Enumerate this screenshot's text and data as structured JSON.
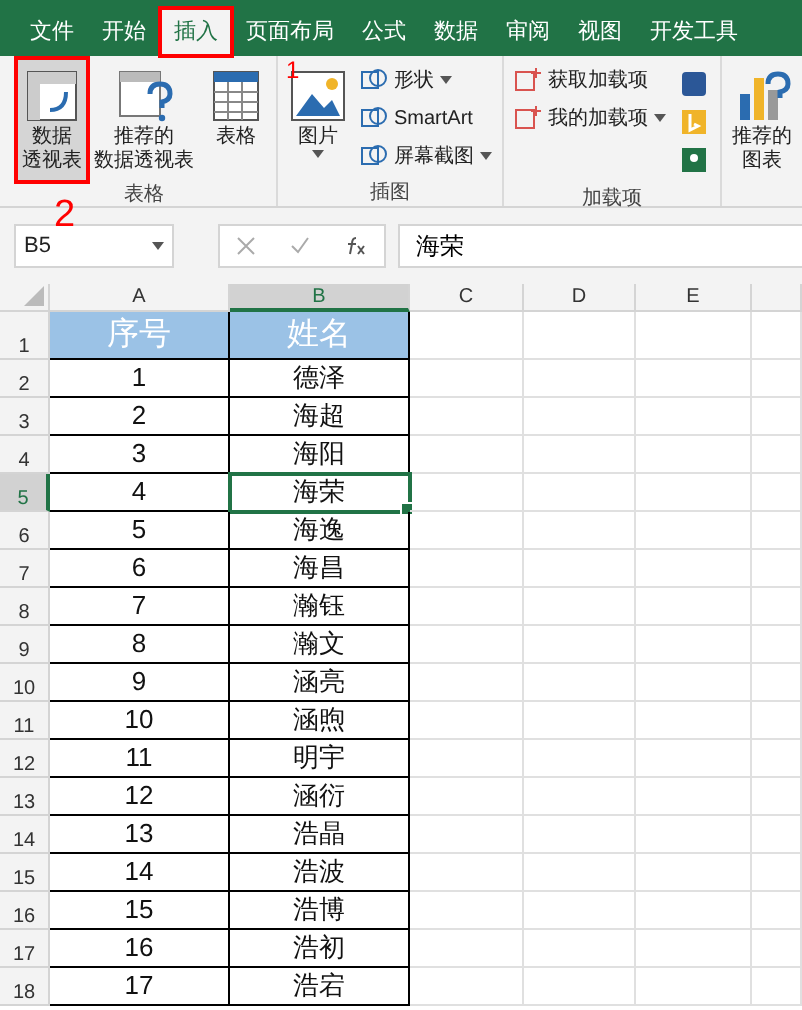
{
  "ribbon_tabs": [
    {
      "label": "文件",
      "selected": false,
      "annotated": false
    },
    {
      "label": "开始",
      "selected": false,
      "annotated": false
    },
    {
      "label": "插入",
      "selected": true,
      "annotated": true
    },
    {
      "label": "页面布局",
      "selected": false,
      "annotated": false
    },
    {
      "label": "公式",
      "selected": false,
      "annotated": false
    },
    {
      "label": "数据",
      "selected": false,
      "annotated": false
    },
    {
      "label": "审阅",
      "selected": false,
      "annotated": false
    },
    {
      "label": "视图",
      "selected": false,
      "annotated": false
    },
    {
      "label": "开发工具",
      "selected": false,
      "annotated": false
    }
  ],
  "ribbon_groups": [
    {
      "label": "表格",
      "items": [
        {
          "kind": "large",
          "lines": [
            "数据",
            "透视表"
          ],
          "highlighted": true,
          "annotated": true
        },
        {
          "kind": "large",
          "lines": [
            "推荐的",
            "数据透视表"
          ],
          "highlighted": false,
          "annotated": false
        },
        {
          "kind": "large",
          "lines": [
            "表格"
          ],
          "highlighted": false,
          "annotated": false
        }
      ]
    },
    {
      "label": "插图",
      "items": [
        {
          "kind": "large",
          "lines": [
            "图片"
          ],
          "dropdown": true
        },
        {
          "kind": "small",
          "label": "形状",
          "dropdown": true
        },
        {
          "kind": "small",
          "label": "SmartArt",
          "dropdown": false
        },
        {
          "kind": "small",
          "label": "屏幕截图",
          "dropdown": true
        }
      ]
    },
    {
      "label": "加载项",
      "items": [
        {
          "kind": "small",
          "label": "获取加载项",
          "dropdown": false
        },
        {
          "kind": "small",
          "label": "我的加载项",
          "dropdown": true
        },
        {
          "kind": "icons"
        }
      ]
    },
    {
      "items": [
        {
          "kind": "large",
          "lines": [
            "推荐的",
            "图表"
          ],
          "highlighted": false,
          "annotated": false
        }
      ]
    }
  ],
  "callouts": [
    {
      "label": "1"
    },
    {
      "label": "2"
    }
  ],
  "name_box": "B5",
  "formula_bar": {
    "value": "海荣"
  },
  "columns": [
    {
      "label": "A",
      "selected": false
    },
    {
      "label": "B",
      "selected": true
    },
    {
      "label": "C",
      "selected": false
    },
    {
      "label": "D",
      "selected": false
    },
    {
      "label": "E",
      "selected": false
    },
    {
      "selected": false
    }
  ],
  "rows": [
    {
      "number": "1",
      "kind": "header",
      "selected": false,
      "cells": [
        "序号",
        "姓名"
      ]
    },
    {
      "number": "2",
      "kind": "data",
      "selected": false,
      "cells": [
        "1",
        "德泽"
      ]
    },
    {
      "number": "3",
      "kind": "data",
      "selected": false,
      "cells": [
        "2",
        "海超"
      ]
    },
    {
      "number": "4",
      "kind": "data",
      "selected": false,
      "cells": [
        "3",
        "海阳"
      ]
    },
    {
      "number": "5",
      "kind": "data",
      "selected": true,
      "cells": [
        "4",
        "海荣"
      ]
    },
    {
      "number": "6",
      "kind": "data",
      "selected": false,
      "cells": [
        "5",
        "海逸"
      ]
    },
    {
      "number": "7",
      "kind": "data",
      "selected": false,
      "cells": [
        "6",
        "海昌"
      ]
    },
    {
      "number": "8",
      "kind": "data",
      "selected": false,
      "cells": [
        "7",
        "瀚钰"
      ]
    },
    {
      "number": "9",
      "kind": "data",
      "selected": false,
      "cells": [
        "8",
        "瀚文"
      ]
    },
    {
      "number": "10",
      "kind": "data",
      "selected": false,
      "cells": [
        "9",
        "涵亮"
      ]
    },
    {
      "number": "11",
      "kind": "data",
      "selected": false,
      "cells": [
        "10",
        "涵煦"
      ]
    },
    {
      "number": "12",
      "kind": "data",
      "selected": false,
      "cells": [
        "11",
        "明宇"
      ]
    },
    {
      "number": "13",
      "kind": "data",
      "selected": false,
      "cells": [
        "12",
        "涵衍"
      ]
    },
    {
      "number": "14",
      "kind": "data",
      "selected": false,
      "cells": [
        "13",
        "浩晶"
      ]
    },
    {
      "number": "15",
      "kind": "data",
      "selected": false,
      "cells": [
        "14",
        "浩波"
      ]
    },
    {
      "number": "16",
      "kind": "data",
      "selected": false,
      "cells": [
        "15",
        "浩博"
      ]
    },
    {
      "number": "17",
      "kind": "data",
      "selected": false,
      "cells": [
        "16",
        "浩初"
      ]
    },
    {
      "number": "18",
      "kind": "data",
      "selected": false,
      "cells": [
        "17",
        "浩宕"
      ]
    }
  ]
}
